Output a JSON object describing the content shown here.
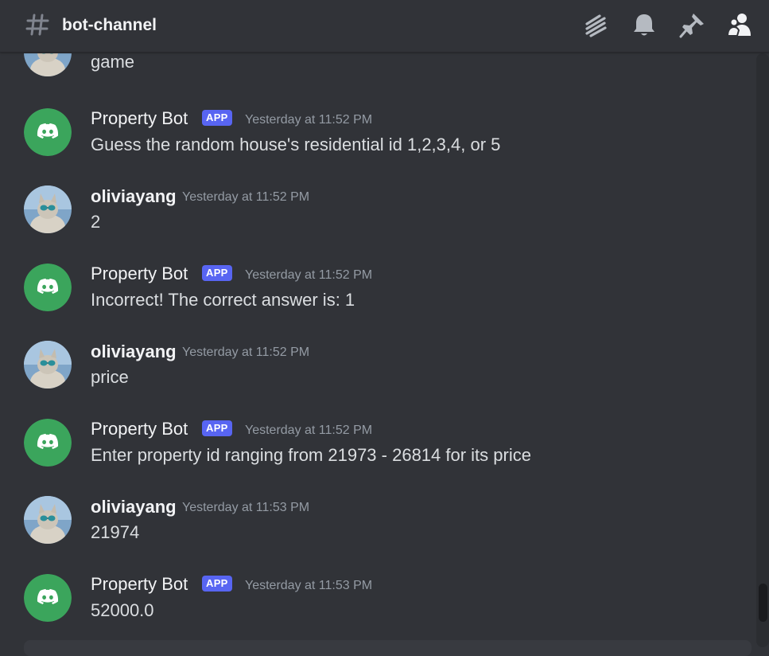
{
  "header": {
    "channel_name": "bot-channel",
    "icons": [
      "hash-icon",
      "threads-icon",
      "notification-bell-icon",
      "pinned-messages-icon",
      "member-list-icon"
    ]
  },
  "messages": [
    {
      "author": "",
      "content": "game",
      "avatar": "user-avatar",
      "partial": true
    },
    {
      "author": "Property Bot",
      "badge": "APP",
      "time": "Yesterday at 11:52 PM",
      "content": "Guess the random house's residential id 1,2,3,4, or 5",
      "avatar": "discord-bot-avatar"
    },
    {
      "author": "oliviayang",
      "time": "Yesterday at 11:52 PM",
      "content": "2",
      "avatar": "user-avatar"
    },
    {
      "author": "Property Bot",
      "badge": "APP",
      "time": "Yesterday at 11:52 PM",
      "content": "Incorrect! The correct answer is: 1",
      "avatar": "discord-bot-avatar"
    },
    {
      "author": "oliviayang",
      "time": "Yesterday at 11:52 PM",
      "content": "price",
      "avatar": "user-avatar"
    },
    {
      "author": "Property Bot",
      "badge": "APP",
      "time": "Yesterday at 11:52 PM",
      "content": "Enter property id ranging from 21973 - 26814 for its price",
      "avatar": "discord-bot-avatar"
    },
    {
      "author": "oliviayang",
      "time": "Yesterday at 11:53 PM",
      "content": "21974",
      "avatar": "user-avatar"
    },
    {
      "author": "Property Bot",
      "badge": "APP",
      "time": "Yesterday at 11:53 PM",
      "content": "52000.0",
      "avatar": "discord-bot-avatar"
    }
  ],
  "colors": {
    "background": "#313338",
    "bot_avatar": "#3ba55c",
    "app_badge": "#5865f2",
    "timestamp": "#949ba4",
    "text": "#dbdee1"
  }
}
